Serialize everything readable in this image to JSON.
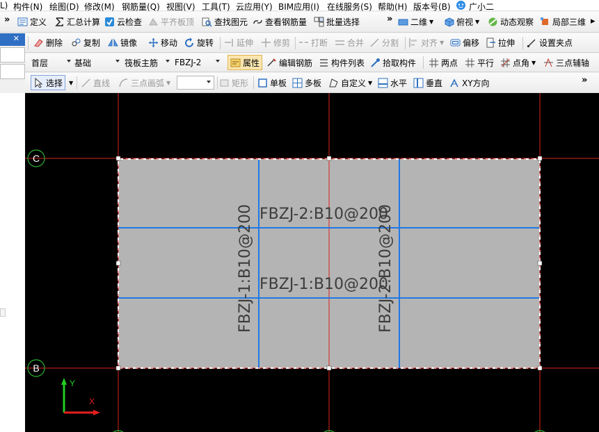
{
  "menubar": [
    {
      "label": "L)"
    },
    {
      "label": "构件(N)"
    },
    {
      "label": "绘图(D)"
    },
    {
      "label": "修改(M)"
    },
    {
      "label": "钢筋量(Q)"
    },
    {
      "label": "视图(V)"
    },
    {
      "label": "工具(T)"
    },
    {
      "label": "云应用(Y)"
    },
    {
      "label": "BIM应用(I)"
    },
    {
      "label": "在线服务(S)"
    },
    {
      "label": "帮助(H)"
    },
    {
      "label": "版本号(B)"
    },
    {
      "label": "广小二"
    }
  ],
  "toolbar1": {
    "define": "定义",
    "sum_calc": "汇总计算",
    "cloud_check": "云检查",
    "align_top": "平齐板顶",
    "find_elem": "查找图元",
    "view_rebar": "查看钢筋量",
    "batch_select": "批量选择",
    "view_mode": "二维",
    "top_view": "俯视",
    "dynamic_view": "动态观察",
    "local_3d": "局部三维"
  },
  "toolbar2": {
    "delete": "删除",
    "copy": "复制",
    "mirror": "镜像",
    "move": "移动",
    "rotate": "旋转",
    "extend": "延伸",
    "trim": "修剪",
    "break": "打断",
    "merge": "合并",
    "split": "分割",
    "align": "对齐",
    "offset": "偏移",
    "stretch": "拉伸",
    "grip": "设置夹点"
  },
  "toolbar3": {
    "floor": "首层",
    "category": "基础",
    "type": "筏板主筋",
    "element": "FBZJ-2",
    "properties": "属性",
    "edit_rebar": "编辑钢筋",
    "elem_list": "构件列表",
    "pick_elem": "拾取构件",
    "two_point": "两点",
    "parallel": "平行",
    "point_angle": "点角",
    "three_point_aux": "三点辅轴"
  },
  "toolbar4": {
    "select": "选择",
    "line": "直线",
    "arc3": "三点画弧",
    "rect": "矩形",
    "single": "单板",
    "multi": "多板",
    "custom": "自定义",
    "horizontal": "水平",
    "vertical": "垂直",
    "xy_dir": "XY方向"
  },
  "canvas": {
    "axis_c": "C",
    "axis_b": "B",
    "label_h2": "FBZJ-2:B10@200",
    "label_h1": "FBZJ-1:B10@200",
    "label_v1": "FBZJ-1:B10@200",
    "label_v2": "FBZJ-2:B10@200",
    "ucs_y": "Y",
    "ucs_x": "X"
  },
  "colors": {
    "canvas_bg": "#000000",
    "slab_fill": "#b4b4b4",
    "grid_line": "#d9231c",
    "rebar_line": "#1e78e6",
    "label_text": "#3c3c3c",
    "axis_circle": "#2fae33"
  }
}
